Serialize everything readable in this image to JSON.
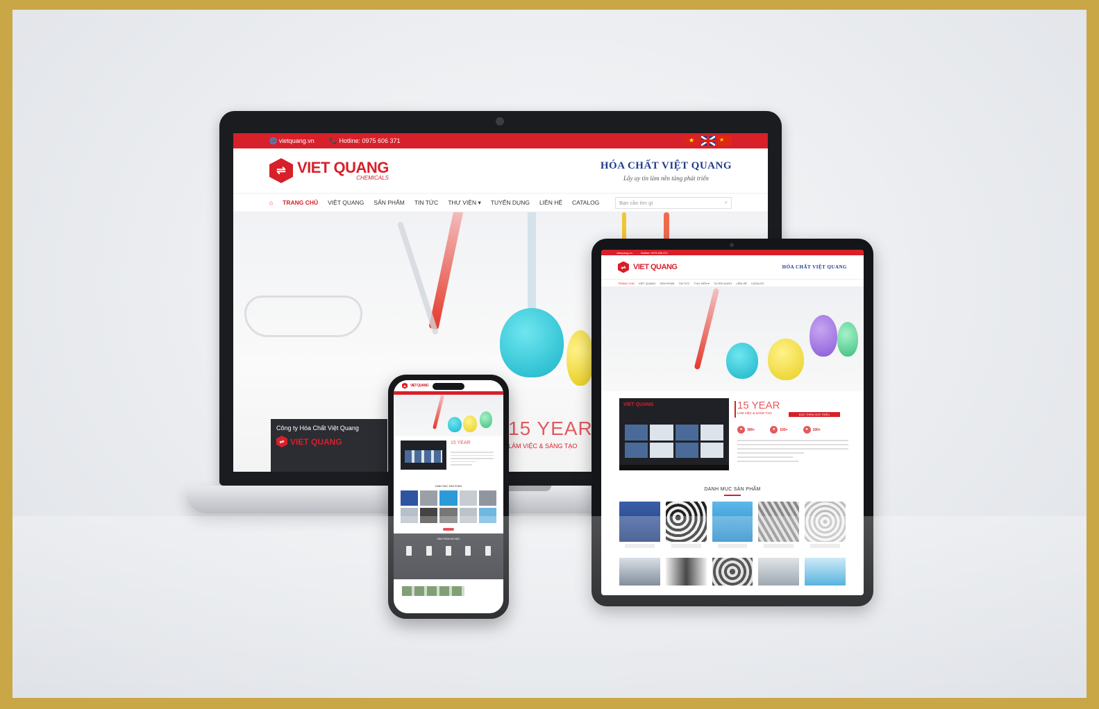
{
  "topbar": {
    "website": "vietquang.vn",
    "hotline": "Hotline: 0975 606 371",
    "flags": [
      "vietnam-flag",
      "uk-flag",
      "china-flag"
    ]
  },
  "brand": {
    "name": "VIET QUANG",
    "sub": "CHEMICALS"
  },
  "slogan": {
    "title": "HÓA CHẤT VIỆT QUANG",
    "tagline": "Lấy uy tín làm nền tảng phát triển"
  },
  "nav": {
    "items": [
      "TRANG CHỦ",
      "VIỆT QUANG",
      "SẢN PHẨM",
      "TIN TỨC",
      "THƯ VIỆN ▾",
      "TUYỂN DỤNG",
      "LIÊN HỆ",
      "CATALOG"
    ],
    "search_placeholder": "Bạn cần tìm gì"
  },
  "hero": {
    "video_title": "Công ty Hóa Chất Việt Quang",
    "years_big": "15 YEAR",
    "years_small": "LÀM VIỆC & SÁNG TẠO"
  },
  "tablet": {
    "years_big": "15 YEAR",
    "years_small": "LÀM VIỆC & SÁNG TẠO",
    "button": "ĐỌC THÊM GIỚI THIỆU",
    "stats": [
      "300+",
      "100+",
      "100+"
    ],
    "category_title": "DANH MỤC SẢN PHẨM"
  },
  "phone": {
    "years_big": "15 YEAR",
    "category_title": "DANH MỤC SẢN PHẨM",
    "products_title": "SẢN PHẨM NỔI BẬT"
  },
  "colors": {
    "brand_red": "#d7202a",
    "brand_blue": "#1e3b8c",
    "gold_frame": "#c9a646"
  }
}
